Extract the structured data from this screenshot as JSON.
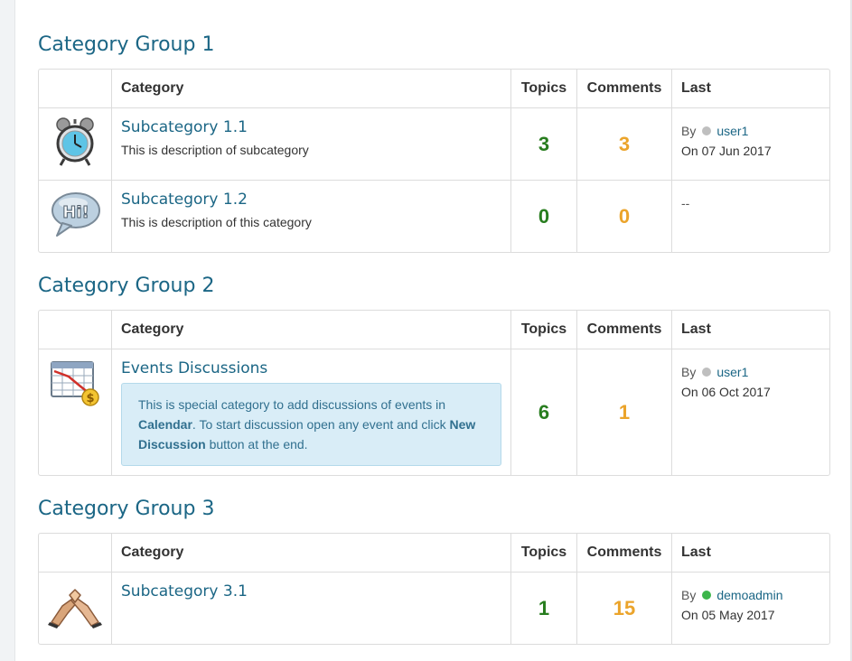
{
  "columns": {
    "category": "Category",
    "topics": "Topics",
    "comments": "Comments",
    "last": "Last"
  },
  "colors": {
    "title": "#1b6685",
    "topics": "#287d1f",
    "comments": "#eba42b",
    "offline": "#bfbfbf",
    "online": "#3cb54a"
  },
  "groups": [
    {
      "title": "Category Group 1",
      "rows": [
        {
          "name": "Subcategory 1.1",
          "description": "This is description of subcategory",
          "icon": "alarm-clock-icon",
          "topics": "3",
          "comments": "3",
          "by": "By",
          "user": "user1",
          "user_status": "offline",
          "on": "On 07 Jun 2017"
        },
        {
          "name": "Subcategory 1.2",
          "description": "This is description of this category",
          "icon": "hi-speech-bubble-icon",
          "topics": "0",
          "comments": "0",
          "last_empty": "--"
        }
      ]
    },
    {
      "title": "Category Group 2",
      "rows": [
        {
          "name": "Events Discussions",
          "icon": "calendar-dollar-icon",
          "info_parts": [
            "This is special category to add discussions of events in ",
            "Calendar",
            ". To start discussion open any event and click ",
            "New Discussion",
            " button at the end."
          ],
          "topics": "6",
          "comments": "1",
          "by": "By",
          "user": "user1",
          "user_status": "offline",
          "on": "On 06 Oct 2017"
        }
      ]
    },
    {
      "title": "Category Group 3",
      "rows": [
        {
          "name": "Subcategory 3.1",
          "icon": "handshake-icon",
          "topics": "1",
          "comments": "15",
          "by": "By",
          "user": "demoadmin",
          "user_status": "online",
          "on": "On 05 May 2017"
        }
      ]
    }
  ]
}
